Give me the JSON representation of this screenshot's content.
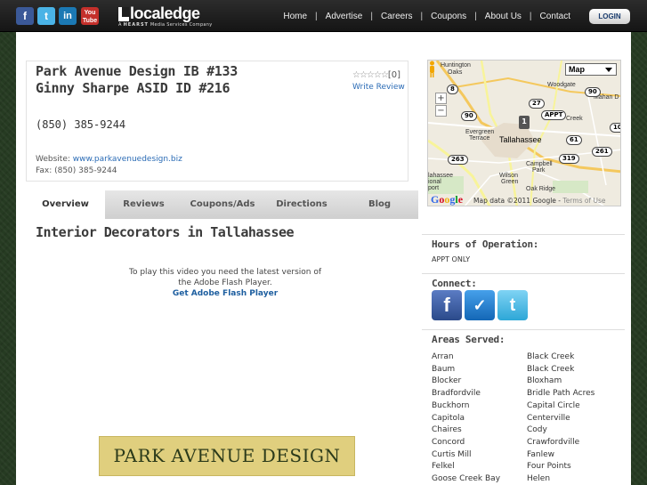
{
  "social": {
    "facebook": "f",
    "twitter": "t",
    "linkedin": "in",
    "youtube": "You Tube"
  },
  "brand": {
    "name": "localedge",
    "sub_prefix": "A",
    "sub_brand": "HEARST",
    "sub_suffix": "Media Services Company"
  },
  "nav": {
    "items": [
      "Home",
      "Advertise",
      "Careers",
      "Coupons",
      "About Us",
      "Contact"
    ],
    "login": "LOGIN"
  },
  "business": {
    "name_line1": "Park Avenue Design IB #133",
    "name_line2": "Ginny Sharpe ASID ID #216",
    "stars": "☆☆☆☆☆",
    "review_count": "[0]",
    "write_review": "Write Review",
    "phone": "(850) 385-9244",
    "website_label": "Website: ",
    "website_url": "www.parkavenuedesign.biz",
    "fax": "Fax: (850) 385-9244"
  },
  "tabs": [
    "Overview",
    "Reviews",
    "Coupons/Ads",
    "Directions",
    "Blog"
  ],
  "active_tab": "Overview",
  "main": {
    "title": "Interior Decorators in Tallahassee",
    "flash_line1": "To play this video you need the latest version of",
    "flash_line2": "the Adobe Flash Player.",
    "flash_link": "Get Adobe Flash Player",
    "banner_text": "PARK AVENUE DESIGN"
  },
  "map": {
    "type": "Map",
    "credit": "Map data ©2011 Google - ",
    "terms": "Terms of Use",
    "google": [
      "G",
      "o",
      "o",
      "g",
      "l",
      "e"
    ],
    "zoom_in": "+",
    "zoom_out": "−",
    "pin_label": "1",
    "labels": {
      "huntington": "Huntington",
      "oaks": "Oaks",
      "woodgate": "Woodgate",
      "evergreen": "Evergreen",
      "terrace": "Terrace",
      "tallahassee": "Tallahassee",
      "mahan": "Mahan D",
      "campbell": "Campbell",
      "park": "Park",
      "wilson": "Wilson",
      "green": "Green",
      "oak_ridge": "Oak Ridge",
      "hasse": "lahassee",
      "airport": "ional",
      "port": "port"
    },
    "shields": [
      "8",
      "90",
      "27",
      "APPT",
      "61",
      "263",
      "319",
      "261",
      "10",
      "Creek",
      "90"
    ]
  },
  "sidebar": {
    "hours_title": "Hours of Operation:",
    "hours_value": "APPT ONLY",
    "connect_title": "Connect:",
    "connect_icons": {
      "facebook": "f",
      "foursquare": "✓",
      "twitter": "t"
    },
    "areas_title": "Areas Served:",
    "areas_col1": [
      "Arran",
      "Baum",
      "Blocker",
      "Bradfordvile",
      "Buckhorn",
      "Capitola",
      "Chaires",
      "Concord",
      "Curtis Mill",
      "Felkel",
      "Goose Creek Bay"
    ],
    "areas_col2": [
      "Black Creek",
      "Black Creek",
      "Bloxham",
      "Bridle Path Acres",
      "Capital Circle",
      "Centerville",
      "Cody",
      "Crawfordville",
      "Fanlew",
      "Four Points",
      "Helen"
    ]
  }
}
